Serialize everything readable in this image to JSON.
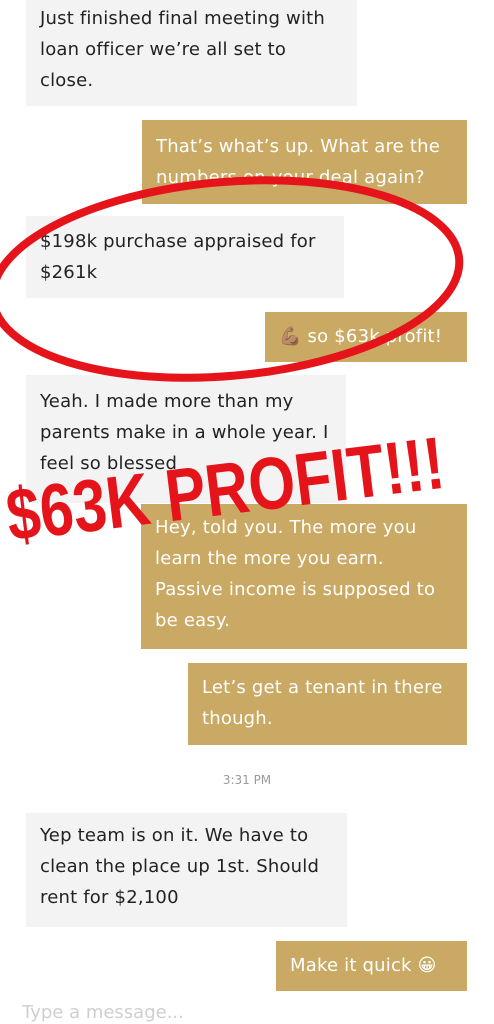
{
  "messages": [
    {
      "side": "in",
      "text": "Just finished final meeting with loan officer we’re all set to close."
    },
    {
      "side": "out",
      "text": "That’s what’s up. What are the numbers on your deal again?"
    },
    {
      "side": "in",
      "text": "$198k purchase appraised for $261k"
    },
    {
      "side": "out",
      "text": "so $63k profit!",
      "emoji": "💪🏽"
    },
    {
      "side": "in",
      "text": "Yeah. I made more than my parents make in a whole year. I feel so blessed"
    },
    {
      "side": "out",
      "text": "Hey, told you. The more you learn the more you earn. Passive income is supposed to be easy."
    },
    {
      "side": "out",
      "text": "Let’s get a tenant in there though."
    },
    {
      "side": "in",
      "text": "Yep team is on it. We have to clean the place up 1st. Should rent for $2,100"
    },
    {
      "side": "out",
      "text": "Make it quick",
      "emoji": "😀"
    }
  ],
  "timestamp": "3:31 PM",
  "composer": {
    "placeholder": "Type a message..."
  },
  "overlay": {
    "headline": "$63K PROFIT!!!",
    "circle_color": "#e5141b",
    "text_color": "#e5141b"
  },
  "colors": {
    "outgoing_bubble": "#c9a963",
    "incoming_bubble": "#f3f3f3"
  }
}
